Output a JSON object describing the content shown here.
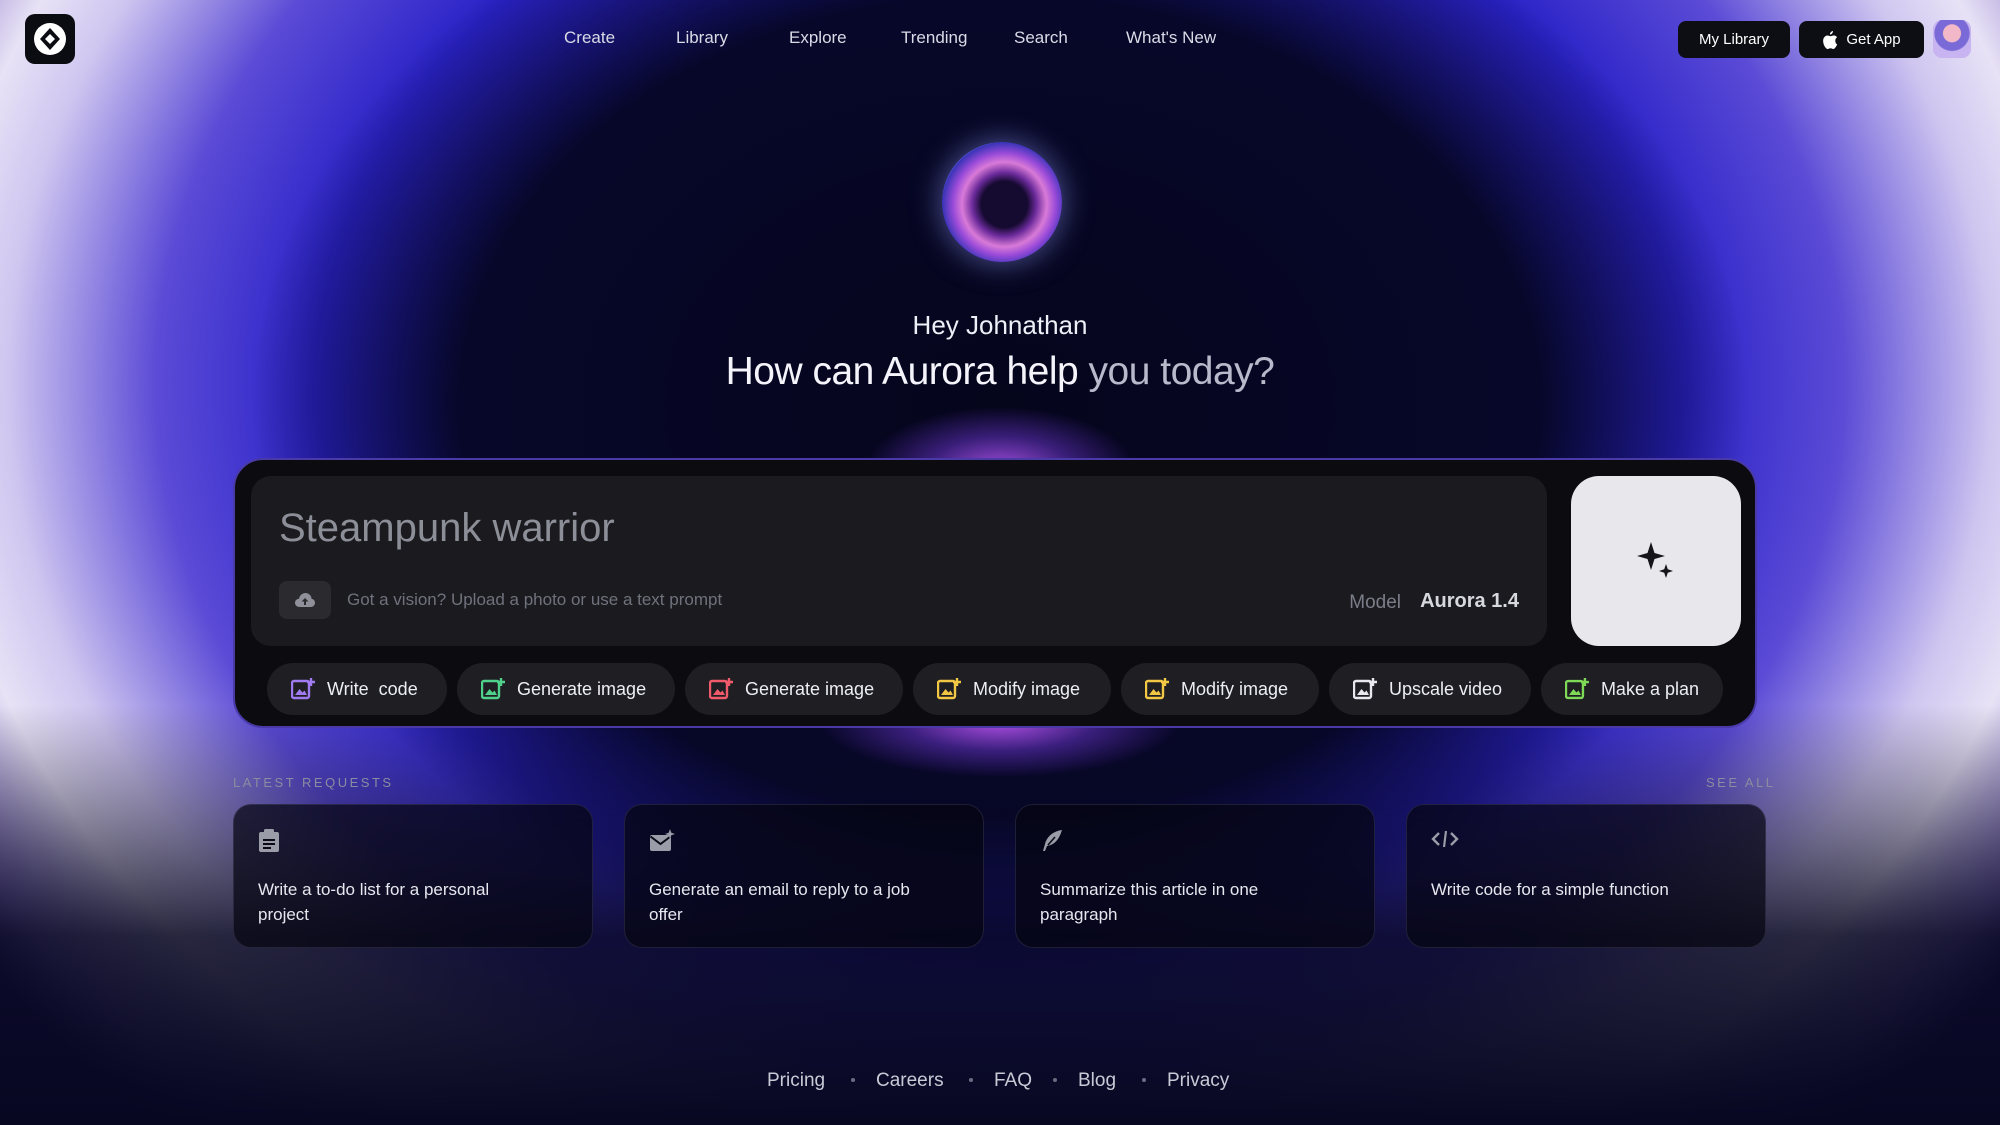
{
  "header": {
    "nav": [
      "Create",
      "Library",
      "Explore",
      "Trending",
      "Search",
      "What's New"
    ],
    "my_library_label": "My Library",
    "get_app_label": "Get App"
  },
  "hero": {
    "greeting": "Hey Johnathan",
    "headline_main": "How can Aurora help",
    "headline_dim": "you today?"
  },
  "prompt": {
    "value": "Steampunk warrior",
    "upload_hint": "Got a vision? Upload a photo or use a text prompt",
    "model_label": "Model",
    "model_value": "Aurora 1.4"
  },
  "chips": [
    {
      "label": "Write  code",
      "icon": "image-plus-icon",
      "color": "#a07af0"
    },
    {
      "label": "Generate image",
      "icon": "image-plus-icon",
      "color": "#4fd18b"
    },
    {
      "label": "Generate image",
      "icon": "image-plus-icon",
      "color": "#f05a6a"
    },
    {
      "label": "Modify image",
      "icon": "image-plus-icon",
      "color": "#f2c744"
    },
    {
      "label": "Modify image",
      "icon": "image-plus-icon",
      "color": "#f2c744"
    },
    {
      "label": "Upscale video",
      "icon": "image-plus-icon",
      "color": "#e8e8ee"
    },
    {
      "label": "Make a plan",
      "icon": "image-plus-icon",
      "color": "#7ed957"
    }
  ],
  "latest": {
    "title": "LATEST REQUESTS",
    "see_all": "SEE ALL",
    "cards": [
      {
        "icon": "clipboard-icon",
        "text": "Write a to-do list for a personal project"
      },
      {
        "icon": "mail-sparkle-icon",
        "text": "Generate an email to reply to a job offer"
      },
      {
        "icon": "quill-icon",
        "text": "Summarize this article in one paragraph"
      },
      {
        "icon": "code-icon",
        "text": "Write code for a simple function"
      }
    ]
  },
  "footer": [
    "Pricing",
    "Careers",
    "FAQ",
    "Blog",
    "Privacy"
  ]
}
